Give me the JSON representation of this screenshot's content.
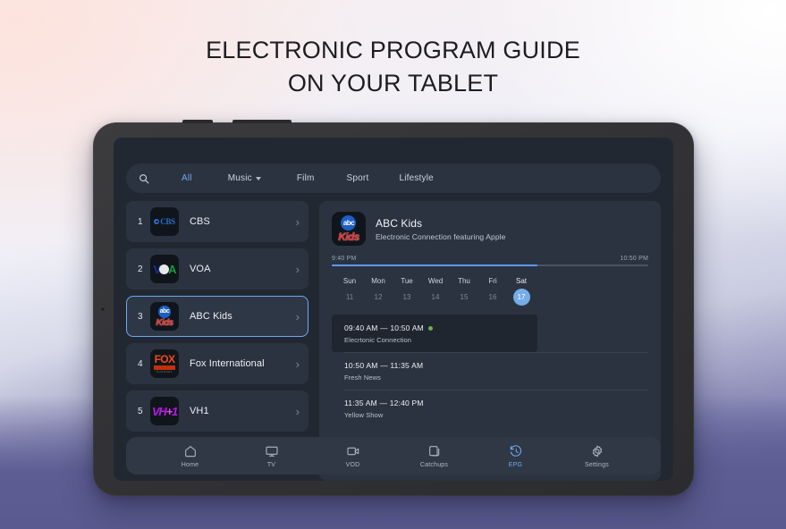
{
  "headline": {
    "line1": "ELECTRONIC PROGRAM GUIDE",
    "line2": "ON YOUR TABLET"
  },
  "filter_bar": {
    "search_icon": "search-icon",
    "chips": [
      {
        "label": "All",
        "active": true,
        "has_caret": false
      },
      {
        "label": "Music",
        "active": false,
        "has_caret": true
      },
      {
        "label": "Film",
        "active": false,
        "has_caret": false
      },
      {
        "label": "Sport",
        "active": false,
        "has_caret": false
      },
      {
        "label": "Lifestyle",
        "active": false,
        "has_caret": false
      }
    ]
  },
  "channels": [
    {
      "number": "1",
      "name": "CBS",
      "logo": "cbs-logo",
      "selected": false
    },
    {
      "number": "2",
      "name": "VOA",
      "logo": "voa-logo",
      "selected": false
    },
    {
      "number": "3",
      "name": "ABC Kids",
      "logo": "abc-kids-logo",
      "selected": true
    },
    {
      "number": "4",
      "name": "Fox International",
      "logo": "fox-logo",
      "selected": false
    },
    {
      "number": "5",
      "name": "VH1",
      "logo": "vh1-logo",
      "selected": false
    }
  ],
  "detail": {
    "channel_title": "ABC Kids",
    "now_playing": "Electronic Connection featuring Apple",
    "timeline": {
      "start_time": "9:40 PM",
      "end_time": "10:50 PM",
      "progress_percent": 65
    },
    "dates": [
      {
        "dow": "Sun",
        "day": "11",
        "active": false
      },
      {
        "dow": "Mon",
        "day": "12",
        "active": false
      },
      {
        "dow": "Tue",
        "day": "13",
        "active": false
      },
      {
        "dow": "Wed",
        "day": "14",
        "active": false
      },
      {
        "dow": "Thu",
        "day": "15",
        "active": false
      },
      {
        "dow": "Fri",
        "day": "16",
        "active": false
      },
      {
        "dow": "Sat",
        "day": "17",
        "active": true
      }
    ],
    "programs": [
      {
        "time": "09:40 AM — 10:50 AM",
        "name": "Elecrtonic Connection",
        "live": true
      },
      {
        "time": "10:50 AM — 11:35 AM",
        "name": "Fresh News",
        "live": false
      },
      {
        "time": "11:35 AM — 12:40 PM",
        "name": "Yellow Show",
        "live": false
      }
    ]
  },
  "bottom_nav": [
    {
      "label": "Home",
      "icon": "home-icon",
      "active": false
    },
    {
      "label": "TV",
      "icon": "monitor-icon",
      "active": false
    },
    {
      "label": "VOD",
      "icon": "video-camera-icon",
      "active": false
    },
    {
      "label": "Catchups",
      "icon": "layers-icon",
      "active": false
    },
    {
      "label": "EPG",
      "icon": "history-clock-icon",
      "active": true
    },
    {
      "label": "Settings",
      "icon": "gear-icon",
      "active": false
    }
  ],
  "colors": {
    "accent_blue": "#6fa8f5",
    "screen_bg": "#222831",
    "panel_bg": "#2b3340",
    "live_green": "#6ab04c",
    "date_active": "#74ade9"
  }
}
